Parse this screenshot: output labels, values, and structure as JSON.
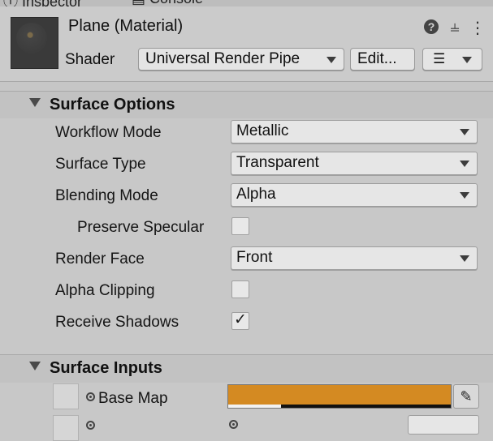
{
  "tabs": [
    {
      "label": "Inspector",
      "icon": "info-icon"
    },
    {
      "label": "Console",
      "icon": "console-icon"
    }
  ],
  "material": {
    "title": "Plane (Material)",
    "shader_label": "Shader",
    "shader_value": "Universal Render Pipe",
    "edit_label": "Edit...",
    "help_icon": "?",
    "presets_icon": "⫨",
    "menu_icon": "⋮",
    "list_icon": "☰"
  },
  "surface_options": {
    "title": "Surface Options",
    "workflow_mode": {
      "label": "Workflow Mode",
      "value": "Metallic"
    },
    "surface_type": {
      "label": "Surface Type",
      "value": "Transparent"
    },
    "blending_mode": {
      "label": "Blending Mode",
      "value": "Alpha"
    },
    "preserve_specular": {
      "label": "Preserve Specular",
      "checked": false
    },
    "render_face": {
      "label": "Render Face",
      "value": "Front"
    },
    "alpha_clipping": {
      "label": "Alpha Clipping",
      "checked": false
    },
    "receive_shadows": {
      "label": "Receive Shadows",
      "checked": true,
      "mark": "✓"
    }
  },
  "surface_inputs": {
    "title": "Surface Inputs",
    "base_map": {
      "label": "Base Map",
      "color": "#d48a22"
    },
    "picker_icon": "✎"
  }
}
